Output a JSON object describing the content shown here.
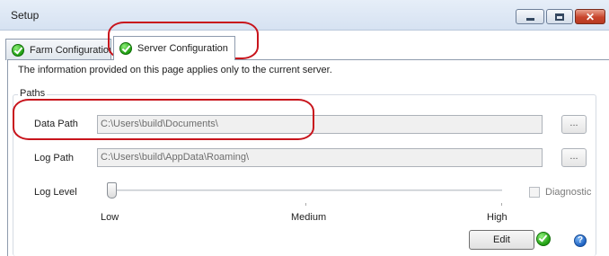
{
  "window": {
    "title": "Setup"
  },
  "tabs": [
    {
      "label": "Farm Configuration",
      "status_icon": "check-icon"
    },
    {
      "label": "Server Configuration",
      "status_icon": "check-icon",
      "active": true
    }
  ],
  "page": {
    "info": "The information provided on this page applies only to the current server.",
    "group_label": "Paths",
    "data_path": {
      "label": "Data Path",
      "value": "C:\\Users\\build\\Documents\\",
      "browse_label": "..."
    },
    "log_path": {
      "label": "Log Path",
      "value": "C:\\Users\\build\\AppData\\Roaming\\",
      "browse_label": "..."
    },
    "log_level": {
      "label": "Log Level",
      "levels": [
        "Low",
        "Medium",
        "High"
      ],
      "selected": "Low"
    },
    "diagnostic": {
      "label": "Diagnostic",
      "checked": false
    },
    "edit_label": "Edit",
    "help_glyph": "?"
  },
  "colors": {
    "annotation": "#c8141c",
    "check": "#27a418"
  }
}
